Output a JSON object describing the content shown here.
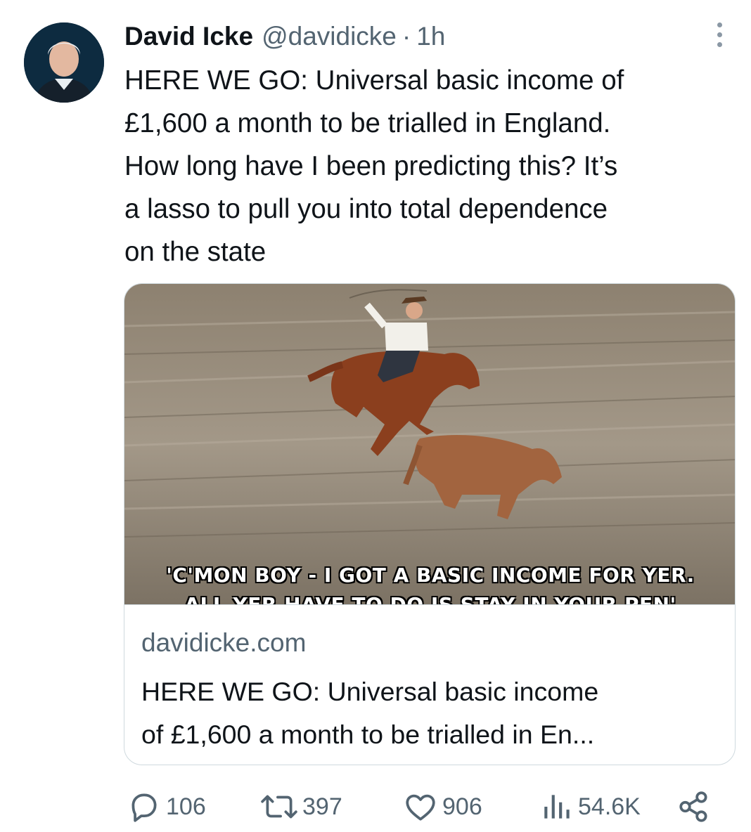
{
  "tweet": {
    "author_name": "David Icke",
    "handle": "@davidicke",
    "separator": "·",
    "time": "1h",
    "text": "HERE WE GO: Universal basic income of\n£1,600 a month to be trialled in England.\nHow long have I been predicting this? It’s\na lasso to pull you into total dependence\non the state"
  },
  "card": {
    "image_caption_line1": "'C'MON BOY - I GOT A BASIC INCOME FOR YER.",
    "image_caption_line2": "ALL YER HAVE TO DO IS STAY IN YOUR PEN'",
    "domain": "davidicke.com",
    "title": "HERE WE GO: Universal basic income\nof £1,600 a month to be trialled in En..."
  },
  "actions": {
    "replies": "106",
    "retweets": "397",
    "likes": "906",
    "views": "54.6K"
  },
  "icons": [
    "more-options-icon",
    "reply-icon",
    "retweet-icon",
    "like-icon",
    "views-icon",
    "share-icon"
  ],
  "colors": {
    "text": "#0f1419",
    "secondary": "#536471",
    "border": "#cfd9de"
  }
}
